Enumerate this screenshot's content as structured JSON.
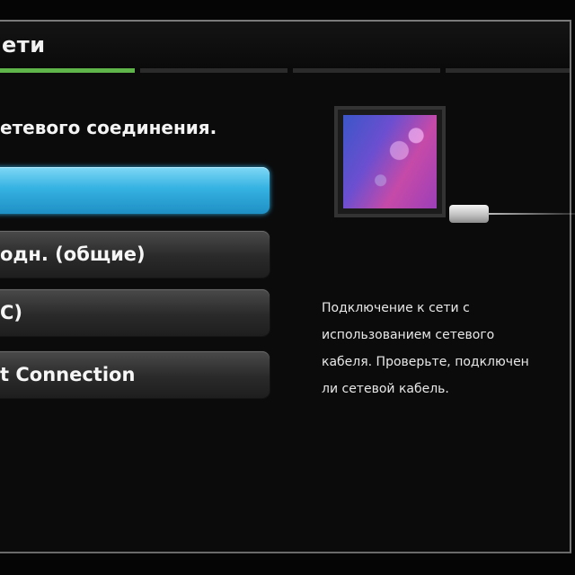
{
  "header": {
    "title": "ети"
  },
  "steps": {
    "count": 4,
    "active_index": 0
  },
  "prompt": "етевого соединения.",
  "options": [
    {
      "label": "",
      "selected": true
    },
    {
      "label": "одн. (общие)",
      "selected": false
    },
    {
      "label": "C)",
      "selected": false
    },
    {
      "label": "t Connection",
      "selected": false
    }
  ],
  "illustration": {
    "icon": "tv-with-network-cable-icon"
  },
  "description": [
    "Подключение к сети с",
    "использованием сетевого",
    "кабеля. Проверьте, подключен",
    "ли сетевой кабель."
  ],
  "colors": {
    "accent_selected": "#35b2e2",
    "step_active": "#5fb54a",
    "step_inactive": "#2b2b2b",
    "background": "#050505"
  }
}
